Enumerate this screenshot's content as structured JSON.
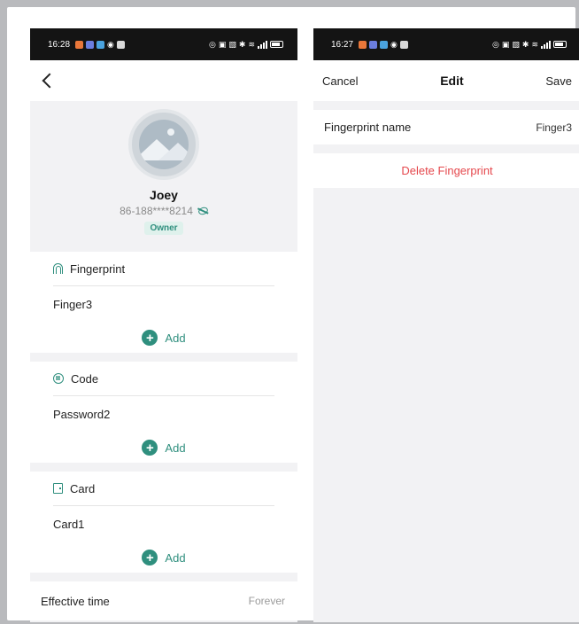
{
  "left_phone": {
    "status_bar": {
      "time": "16:28"
    },
    "user": {
      "name": "Joey",
      "phone": "86-188****8214",
      "role_badge": "Owner"
    },
    "sections": [
      {
        "title": "Fingerprint",
        "icon": "fingerprint-icon",
        "item": "Finger3",
        "add_label": "Add"
      },
      {
        "title": "Code",
        "icon": "keypad-icon",
        "item": "Password2",
        "add_label": "Add"
      },
      {
        "title": "Card",
        "icon": "card-icon",
        "item": "Card1",
        "add_label": "Add"
      }
    ],
    "effective_time": {
      "label": "Effective time",
      "value": "Forever"
    }
  },
  "right_phone": {
    "status_bar": {
      "time": "16:27"
    },
    "header": {
      "cancel_label": "Cancel",
      "title": "Edit",
      "save_label": "Save"
    },
    "fingerprint_name": {
      "label": "Fingerprint name",
      "value": "Finger3"
    },
    "delete_label": "Delete Fingerprint"
  },
  "colors": {
    "accent": "#2f8f7e",
    "danger": "#e5484d",
    "statusbar": "#141414",
    "background": "#f2f2f4"
  }
}
